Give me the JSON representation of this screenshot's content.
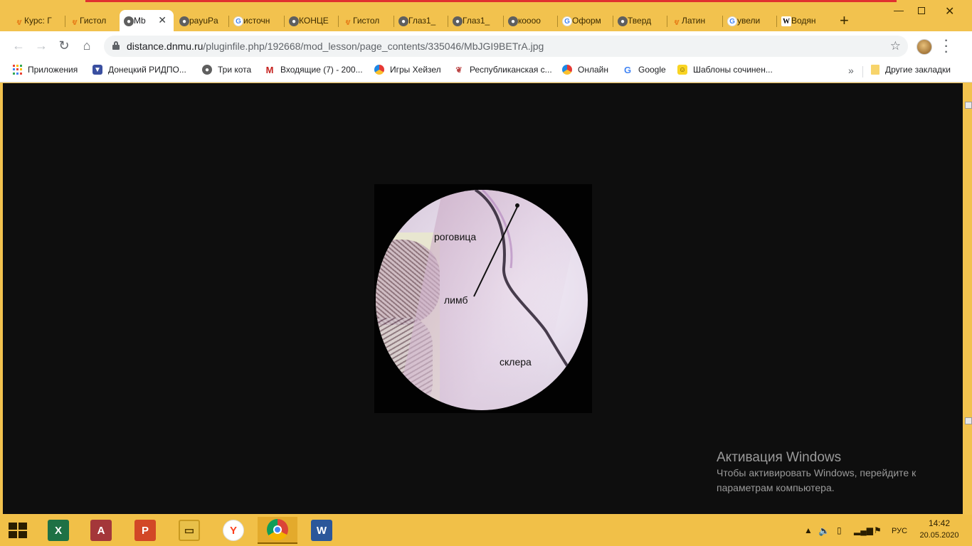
{
  "browser": {
    "tabs": [
      {
        "label": "Курс: Г",
        "icon": "moodle-icon"
      },
      {
        "label": "Гистол",
        "icon": "moodle-icon"
      },
      {
        "label": "Mb",
        "icon": "globe-icon",
        "active": true
      },
      {
        "label": "payuPa",
        "icon": "globe-icon"
      },
      {
        "label": "источн",
        "icon": "google-icon"
      },
      {
        "label": "КОНЦЕ",
        "icon": "globe-icon"
      },
      {
        "label": "Гистол",
        "icon": "moodle-icon"
      },
      {
        "label": "Глаз1_",
        "icon": "globe-icon"
      },
      {
        "label": "Глаз1_",
        "icon": "globe-icon"
      },
      {
        "label": "кoooo",
        "icon": "globe-icon"
      },
      {
        "label": "Оформ",
        "icon": "google-icon"
      },
      {
        "label": "Тверд",
        "icon": "globe-icon"
      },
      {
        "label": "Латин",
        "icon": "moodle-icon"
      },
      {
        "label": "увели",
        "icon": "google-icon"
      },
      {
        "label": "Водян",
        "icon": "wikipedia-icon"
      }
    ],
    "url_domain": "distance.dnmu.ru",
    "url_path": "/pluginfile.php/192668/mod_lesson/page_contents/335046/MbJGI9BETrA.jpg",
    "bookmarks": [
      {
        "label": "Приложения",
        "icon": "apps-icon"
      },
      {
        "label": "Донецкий РИДПО...",
        "icon": "crest-icon"
      },
      {
        "label": "Три кота",
        "icon": "globe-icon"
      },
      {
        "label": "Входящие (7) - 200...",
        "icon": "gmail-icon"
      },
      {
        "label": "Игры Хейзел",
        "icon": "games-icon"
      },
      {
        "label": "Республиканская с...",
        "icon": "emblem-icon"
      },
      {
        "label": "Онлайн",
        "icon": "games-icon"
      },
      {
        "label": "Google",
        "icon": "google-icon"
      },
      {
        "label": "Шаблоны сочинен...",
        "icon": "smiley-icon"
      }
    ],
    "other_bookmarks": "Другие закладки"
  },
  "image": {
    "labels": {
      "cornea": "роговица",
      "limbus": "лимб",
      "sclera": "склера"
    }
  },
  "activation": {
    "title": "Активация Windows",
    "line1": "Чтобы активировать Windows, перейдите к",
    "line2": "параметрам компьютера."
  },
  "taskbar": {
    "apps": [
      "excel-icon",
      "access-icon",
      "powerpoint-icon",
      "file-explorer-icon",
      "yandex-icon",
      "chrome-icon",
      "word-icon"
    ],
    "language": "РУС",
    "time": "14:42",
    "date": "20.05.2020"
  },
  "colors": {
    "frame": "#f2c24e",
    "viewport_bg": "#0e0e0e"
  }
}
